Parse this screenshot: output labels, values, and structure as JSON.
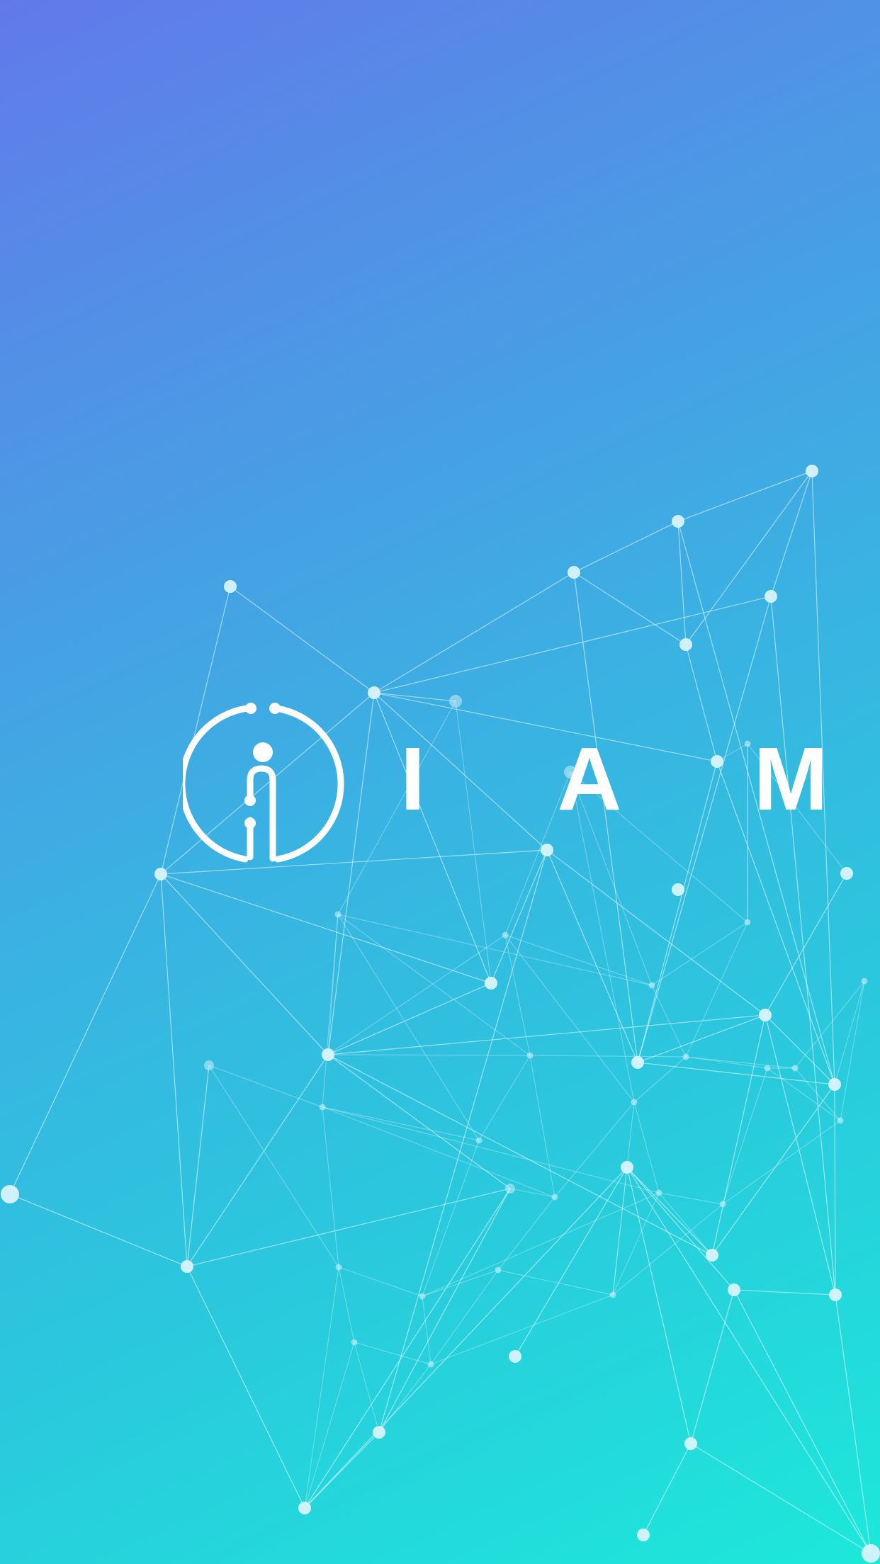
{
  "splash": {
    "brand_name": "I A M",
    "logo_icon": "i-circle-logo-icon",
    "background_art": "network-graph",
    "colors": {
      "gradient_start": "#6279ea",
      "gradient_end": "#1de8da",
      "node": "#d7f3fb",
      "line": "#e6f8ff",
      "logo": "#ffffff"
    }
  }
}
